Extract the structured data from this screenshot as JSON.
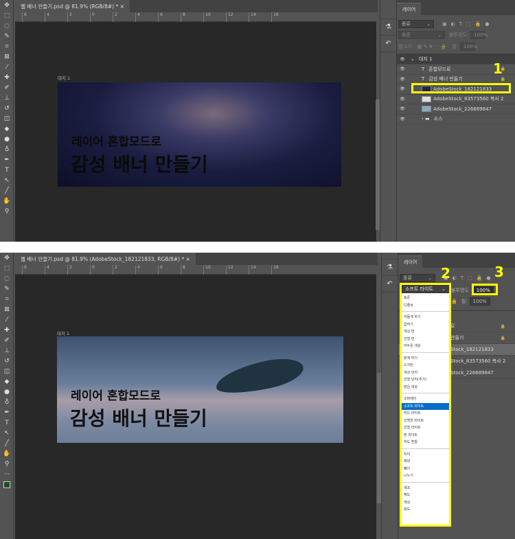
{
  "top": {
    "tab_title": "웹 배너 만들기.psd @ 81.9% (RGB/8#) *",
    "ruler": [
      "6",
      "4",
      "2",
      "0",
      "2",
      "4",
      "6",
      "8",
      "10",
      "12",
      "14",
      "16"
    ],
    "artboard_label": "대지 1",
    "headline_small": "레이어 혼합모드로",
    "headline_big": "감성 배너 만들기",
    "panel_title": "레이어",
    "filter_label": "종류",
    "blend_mode": "표준",
    "opacity_label": "불투명도:",
    "opacity_value": "100%",
    "lock_label": "잠그기:",
    "fill_label": "칠:",
    "fill_value": "100%",
    "layers": [
      {
        "name": "대지 1",
        "type": "artboard"
      },
      {
        "name": "혼합모드로",
        "type": "text"
      },
      {
        "name": "감성 배너 만들기",
        "type": "text"
      },
      {
        "name": "AdobeStock_182121833",
        "type": "image"
      },
      {
        "name": "AdobeStock_83573560 복사 2",
        "type": "image"
      },
      {
        "name": "AdobeStock_226689847",
        "type": "image"
      },
      {
        "name": "소스",
        "type": "folder"
      }
    ],
    "annotation": "1"
  },
  "bottom": {
    "tab_title": "웹 배너 만들기.psd @ 81.9% (AdobeStock_182121833, RGB/8#) *",
    "ruler": [
      "6",
      "4",
      "2",
      "0",
      "2",
      "4",
      "6",
      "8",
      "10",
      "12",
      "14",
      "16"
    ],
    "artboard_label": "대지 1",
    "headline_small": "레이어 혼합모드로",
    "headline_big": "감성 배너 만들기",
    "panel_title": "레이어",
    "filter_label": "종류",
    "blend_mode": "소프트 라이트",
    "opacity_label": "불투명도",
    "opacity_value": "100%",
    "fill_label": "칠:",
    "fill_value": "100%",
    "layers_partial": [
      "로",
      "만들기",
      "Stock_182121833",
      "Stock_83573560 복사 2",
      "Stock_226689847"
    ],
    "annotation_2": "2",
    "annotation_3": "3",
    "blend_groups": [
      [
        "표준",
        "디졸브"
      ],
      [
        "어둡게 하기",
        "곱하기",
        "색상 번",
        "선형 번",
        "어두운 색상"
      ],
      [
        "밝게 하기",
        "스크린",
        "색상 닷지",
        "선형 닷지(추가)",
        "밝은 색상"
      ],
      [
        "오버레이",
        "소프트 라이트",
        "하드 라이트",
        "선명한 라이트",
        "선형 라이트",
        "핀 라이트",
        "하드 혼합"
      ],
      [
        "차이",
        "제외",
        "빼기",
        "나누기"
      ],
      [
        "색조",
        "채도",
        "색상",
        "광도"
      ]
    ]
  },
  "colors": {
    "highlight": "#ffff00",
    "selected": "#0a6dc8"
  }
}
